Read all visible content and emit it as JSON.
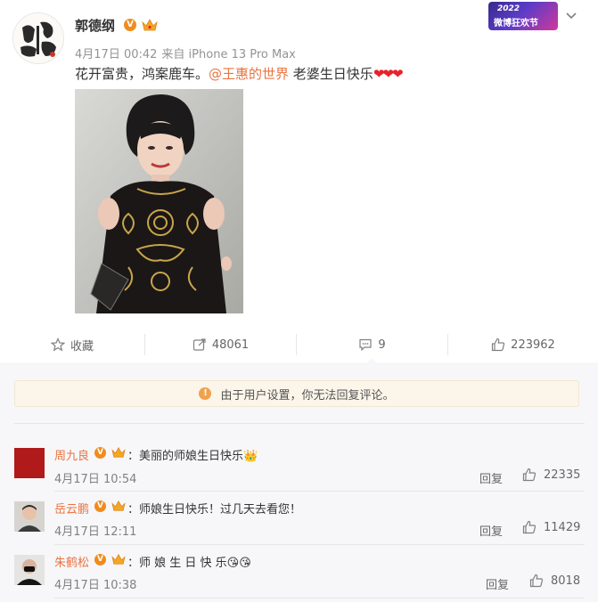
{
  "post": {
    "username": "郭德纲",
    "timestamp": "4月17日 00:42",
    "source": "来自 iPhone 13 Pro Max",
    "text_before": "花开富贵，鸿案鹿车。",
    "mention": "@王惠的世界",
    "text_after": " 老婆生日快乐",
    "hearts": "❤❤❤",
    "promo_badge": {
      "year": "2022",
      "text": "微博狂欢节"
    }
  },
  "actions": {
    "favorite": {
      "label": "收藏",
      "icon": "star-icon"
    },
    "repost": {
      "count": "48061",
      "icon": "repost-icon"
    },
    "comment": {
      "count": "9",
      "icon": "comment-icon"
    },
    "like": {
      "count": "223962",
      "icon": "thumbs-up-icon"
    }
  },
  "notice": "由于用户设置，你无法回复评论。",
  "comments": [
    {
      "name": "周九良",
      "text": "：美丽的师娘生日快乐",
      "emoji": "👑",
      "time": "4月17日 10:54",
      "reply": "回复",
      "likes": "22335"
    },
    {
      "name": "岳云鹏",
      "text": "：师娘生日快乐！过几天去看您！",
      "emoji": "",
      "time": "4月17日 12:11",
      "reply": "回复",
      "likes": "11429"
    },
    {
      "name": "朱鹤松",
      "text": "：师 娘 生 日 快 乐",
      "emoji": "😘😘",
      "time": "4月17日 10:38",
      "reply": "回复",
      "likes": "8018"
    }
  ],
  "colors": {
    "accent": "#eb7340",
    "verified": "#f08c1e",
    "heart": "#e8212b"
  }
}
